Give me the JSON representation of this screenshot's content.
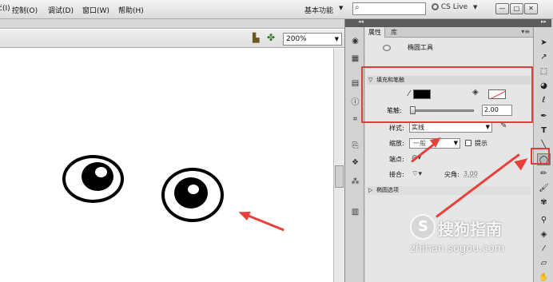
{
  "menubar": {
    "items": [
      "ć(I)",
      "控制(O)",
      "调试(D)",
      "窗口(W)",
      "帮助(H)"
    ],
    "workspace": "基本功能",
    "search_placeholder": "",
    "cslive": "CS Live",
    "window_buttons": [
      "—",
      "□",
      "✕"
    ]
  },
  "editbar": {
    "zoom": "200%"
  },
  "panel": {
    "tabs": [
      "属性",
      "库"
    ],
    "tool_name": "椭圆工具",
    "fill_stroke": {
      "title": "填充和笔触",
      "stroke_label": "笔触:",
      "stroke_value": "2.00",
      "style_label": "样式:",
      "style_value": "实线",
      "scale_label": "缩放:",
      "scale_value": "一般",
      "hint_label": "提示",
      "cap_label": "端点:",
      "join_label": "接合:",
      "miter_label": "尖角:",
      "miter_value": "3.00"
    },
    "ellipse_options": {
      "title": "椭圆选项"
    }
  },
  "watermark": {
    "brand": "搜狗指南",
    "url": "zhinan.sogou.com"
  },
  "colors": {
    "annotation": "#e8403a",
    "fill_swatch": "#000000"
  }
}
